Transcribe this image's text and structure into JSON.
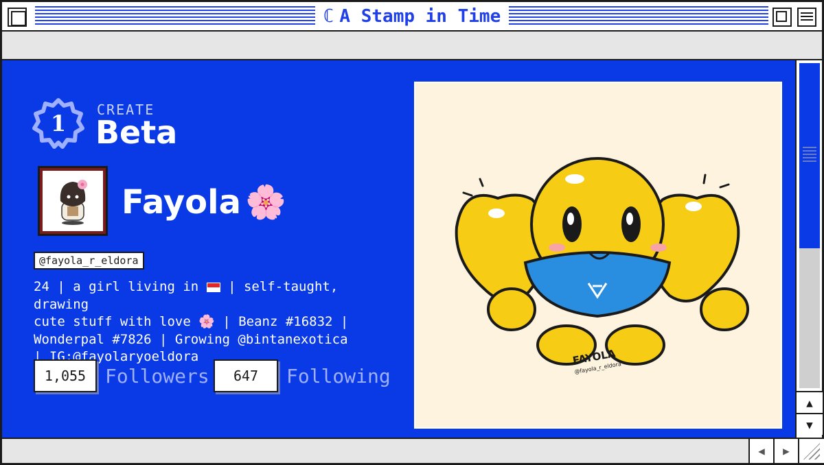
{
  "window": {
    "title": "A Stamp in Time",
    "logo_glyph": "ℂ"
  },
  "header": {
    "step_number": "1",
    "create_label": "CREATE",
    "create_title": "Beta"
  },
  "profile": {
    "name": "Fayola",
    "name_emoji": "🌸",
    "handle": "@fayola_r_eldora",
    "bio": {
      "line1_a": "24 | a girl living in ",
      "line1_b": " | self-taught, drawing",
      "line2_a": "cute stuff with love ",
      "line2_emoji": "🌸",
      "line2_b": " | Beanz #16832 |",
      "line3": "Wonderpal #7826 | Growing @bintanexotica",
      "line4": "| IG:@fayolaryoeldora"
    },
    "followers_count": "1,055",
    "followers_label": "Followers",
    "following_count": "647",
    "following_label": "Following"
  },
  "artwork": {
    "signature": "FAYOLA",
    "signature_handle": "@fayola_r_eldora"
  },
  "icons": {
    "close": "close-box-icon",
    "zoom": "zoom-box-icon",
    "collapse": "collapse-box-icon",
    "scroll_up": "▲",
    "scroll_down": "▼",
    "scroll_left": "◀",
    "scroll_right": "▶"
  },
  "colors": {
    "accent_blue": "#0a3ae6",
    "title_blue": "#1f3fe8",
    "art_background": "#fdf3df",
    "character_yellow": "#f6cc14",
    "shorts_blue": "#2a8ee0"
  }
}
